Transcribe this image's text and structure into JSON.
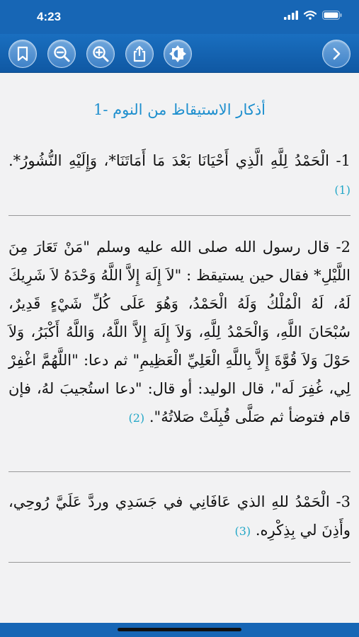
{
  "status": {
    "time": "4:23"
  },
  "toolbar": {
    "icons": [
      "bookmark-icon",
      "zoom-out-icon",
      "zoom-in-icon",
      "share-icon",
      "brightness-icon",
      "next-icon"
    ]
  },
  "content": {
    "heading": "1- أذكار الاستيقاظ من النوم",
    "p1": "1- الْحَمْدُ لِلَّهِ الَّذِي أَحْيَانَا بَعْدَ مَا أَمَاتَنَا*، وَإِلَيْهِ النُّشُورُ*.",
    "p1_ref": "(1)",
    "p2": "2- قال رسول الله صلى الله عليه وسلم \"مَنْ تَعَارَ مِنَ اللَّيْلِ* فقال حين يستيقظ : \"لاَ إِلَهَ إِلاَّ اللَّهُ وَحْدَهُ لاَ شَرِيكَ لَهُ، لَهُ الْمُلْكُ وَلَهُ الْحَمْدُ، وَهُوَ عَلَى كُلِّ شَيْءٍ قَدِيرٌ، سُبْحَانَ اللَّهِ، وَالْحَمْدُ لِلَّهِ، وَلاَ إِلَهَ إِلاَّ اللَّهُ، وَاللَّهُ أَكْبَرُ، وَلاَ حَوْلَ وَلاَ قُوَّةَ إِلاَّ بِاللَّهِ الْعَلِيِّ الْعَظِيمِ\" ثم دعا: \"اللَّهُمَّ اغْفِرْ لِي، غُفِرَ لَه\"، قال الوليد: أو قال: \"دعا استُجيبَ لهُ، فإن قام فتوضأ ثم صَلَّى قُبِلَتْ صَلاتُهُ\".",
    "p2_ref": "(2)",
    "p3": "3- الْحَمْدُ للهِ الذي عَافَانِي في جَسَدِي وردَّ عَلَيَّ رُوحِي، وأَذِنَ لي بِذِكْرِه.",
    "p3_ref": "(3)"
  }
}
